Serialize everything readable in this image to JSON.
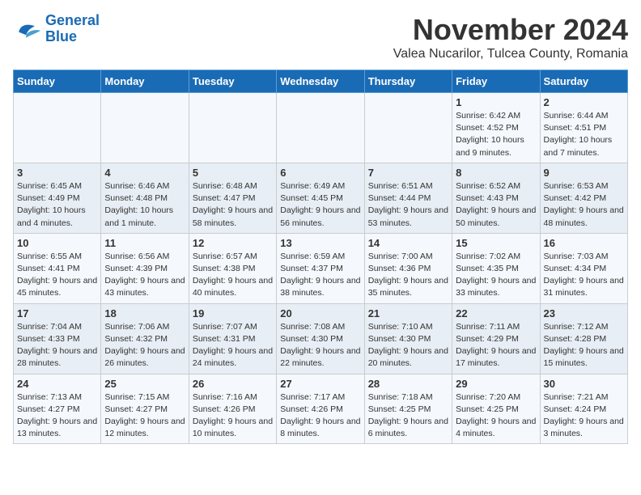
{
  "logo": {
    "line1": "General",
    "line2": "Blue"
  },
  "title": "November 2024",
  "location": "Valea Nucarilor, Tulcea County, Romania",
  "headers": [
    "Sunday",
    "Monday",
    "Tuesday",
    "Wednesday",
    "Thursday",
    "Friday",
    "Saturday"
  ],
  "weeks": [
    [
      {
        "day": "",
        "info": ""
      },
      {
        "day": "",
        "info": ""
      },
      {
        "day": "",
        "info": ""
      },
      {
        "day": "",
        "info": ""
      },
      {
        "day": "",
        "info": ""
      },
      {
        "day": "1",
        "info": "Sunrise: 6:42 AM\nSunset: 4:52 PM\nDaylight: 10 hours and 9 minutes."
      },
      {
        "day": "2",
        "info": "Sunrise: 6:44 AM\nSunset: 4:51 PM\nDaylight: 10 hours and 7 minutes."
      }
    ],
    [
      {
        "day": "3",
        "info": "Sunrise: 6:45 AM\nSunset: 4:49 PM\nDaylight: 10 hours and 4 minutes."
      },
      {
        "day": "4",
        "info": "Sunrise: 6:46 AM\nSunset: 4:48 PM\nDaylight: 10 hours and 1 minute."
      },
      {
        "day": "5",
        "info": "Sunrise: 6:48 AM\nSunset: 4:47 PM\nDaylight: 9 hours and 58 minutes."
      },
      {
        "day": "6",
        "info": "Sunrise: 6:49 AM\nSunset: 4:45 PM\nDaylight: 9 hours and 56 minutes."
      },
      {
        "day": "7",
        "info": "Sunrise: 6:51 AM\nSunset: 4:44 PM\nDaylight: 9 hours and 53 minutes."
      },
      {
        "day": "8",
        "info": "Sunrise: 6:52 AM\nSunset: 4:43 PM\nDaylight: 9 hours and 50 minutes."
      },
      {
        "day": "9",
        "info": "Sunrise: 6:53 AM\nSunset: 4:42 PM\nDaylight: 9 hours and 48 minutes."
      }
    ],
    [
      {
        "day": "10",
        "info": "Sunrise: 6:55 AM\nSunset: 4:41 PM\nDaylight: 9 hours and 45 minutes."
      },
      {
        "day": "11",
        "info": "Sunrise: 6:56 AM\nSunset: 4:39 PM\nDaylight: 9 hours and 43 minutes."
      },
      {
        "day": "12",
        "info": "Sunrise: 6:57 AM\nSunset: 4:38 PM\nDaylight: 9 hours and 40 minutes."
      },
      {
        "day": "13",
        "info": "Sunrise: 6:59 AM\nSunset: 4:37 PM\nDaylight: 9 hours and 38 minutes."
      },
      {
        "day": "14",
        "info": "Sunrise: 7:00 AM\nSunset: 4:36 PM\nDaylight: 9 hours and 35 minutes."
      },
      {
        "day": "15",
        "info": "Sunrise: 7:02 AM\nSunset: 4:35 PM\nDaylight: 9 hours and 33 minutes."
      },
      {
        "day": "16",
        "info": "Sunrise: 7:03 AM\nSunset: 4:34 PM\nDaylight: 9 hours and 31 minutes."
      }
    ],
    [
      {
        "day": "17",
        "info": "Sunrise: 7:04 AM\nSunset: 4:33 PM\nDaylight: 9 hours and 28 minutes."
      },
      {
        "day": "18",
        "info": "Sunrise: 7:06 AM\nSunset: 4:32 PM\nDaylight: 9 hours and 26 minutes."
      },
      {
        "day": "19",
        "info": "Sunrise: 7:07 AM\nSunset: 4:31 PM\nDaylight: 9 hours and 24 minutes."
      },
      {
        "day": "20",
        "info": "Sunrise: 7:08 AM\nSunset: 4:30 PM\nDaylight: 9 hours and 22 minutes."
      },
      {
        "day": "21",
        "info": "Sunrise: 7:10 AM\nSunset: 4:30 PM\nDaylight: 9 hours and 20 minutes."
      },
      {
        "day": "22",
        "info": "Sunrise: 7:11 AM\nSunset: 4:29 PM\nDaylight: 9 hours and 17 minutes."
      },
      {
        "day": "23",
        "info": "Sunrise: 7:12 AM\nSunset: 4:28 PM\nDaylight: 9 hours and 15 minutes."
      }
    ],
    [
      {
        "day": "24",
        "info": "Sunrise: 7:13 AM\nSunset: 4:27 PM\nDaylight: 9 hours and 13 minutes."
      },
      {
        "day": "25",
        "info": "Sunrise: 7:15 AM\nSunset: 4:27 PM\nDaylight: 9 hours and 12 minutes."
      },
      {
        "day": "26",
        "info": "Sunrise: 7:16 AM\nSunset: 4:26 PM\nDaylight: 9 hours and 10 minutes."
      },
      {
        "day": "27",
        "info": "Sunrise: 7:17 AM\nSunset: 4:26 PM\nDaylight: 9 hours and 8 minutes."
      },
      {
        "day": "28",
        "info": "Sunrise: 7:18 AM\nSunset: 4:25 PM\nDaylight: 9 hours and 6 minutes."
      },
      {
        "day": "29",
        "info": "Sunrise: 7:20 AM\nSunset: 4:25 PM\nDaylight: 9 hours and 4 minutes."
      },
      {
        "day": "30",
        "info": "Sunrise: 7:21 AM\nSunset: 4:24 PM\nDaylight: 9 hours and 3 minutes."
      }
    ]
  ]
}
